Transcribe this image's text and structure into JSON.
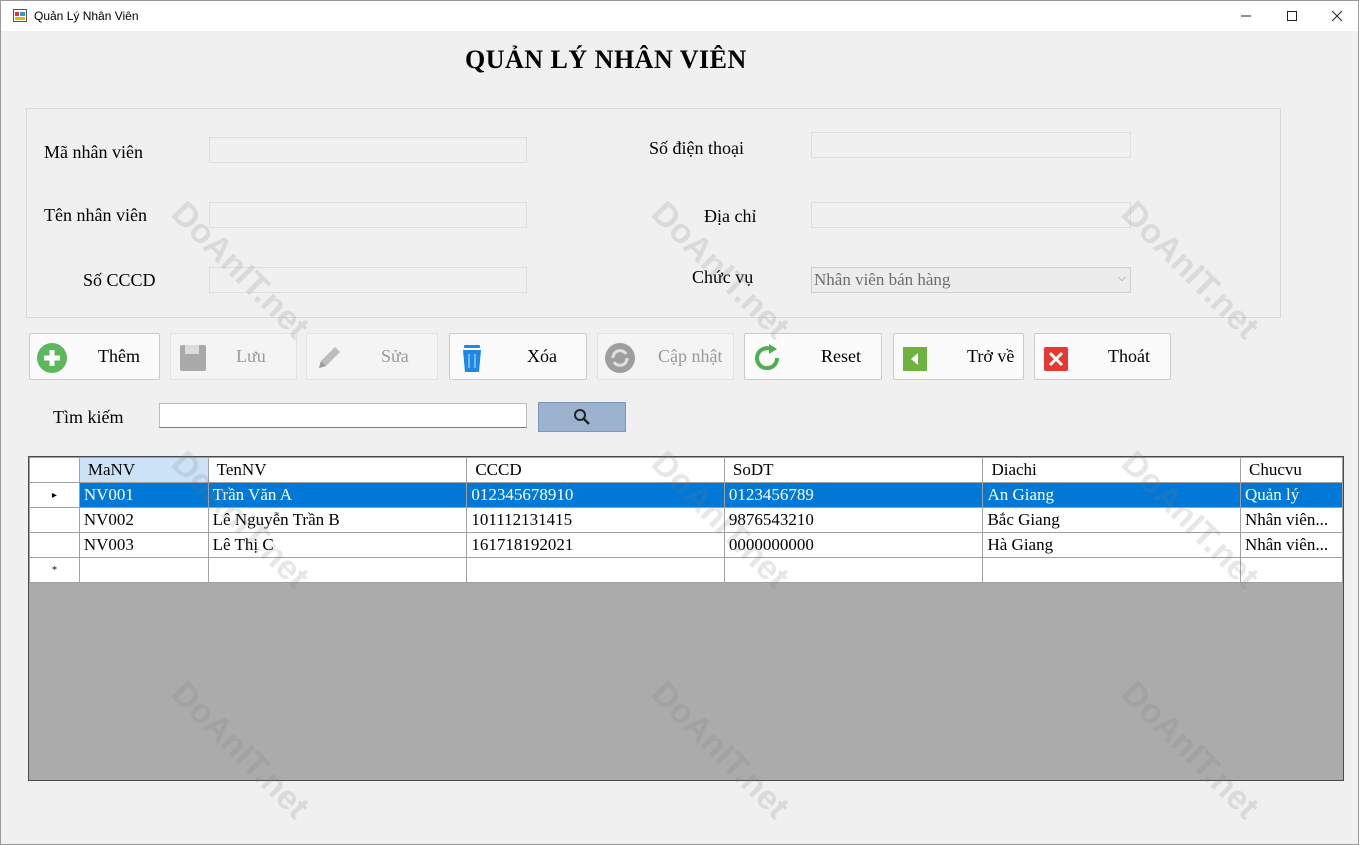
{
  "window": {
    "title": "Quản Lý Nhân Viên",
    "controls": {
      "minimize": "—",
      "maximize": "☐",
      "close": "✕"
    }
  },
  "heading": "QUẢN LÝ NHÂN VIÊN",
  "form": {
    "ma_nv_label": "Mã nhân viên",
    "ten_nv_label": "Tên nhân viên",
    "cccd_label": "Số CCCD",
    "sdt_label": "Số điện thoại",
    "diachi_label": "Địa chỉ",
    "chucvu_label": "Chức vụ",
    "ma_nv_value": "",
    "ten_nv_value": "",
    "cccd_value": "",
    "sdt_value": "",
    "diachi_value": "",
    "chucvu_selected": "Nhân viên bán hàng"
  },
  "toolbar": {
    "them": "Thêm",
    "luu": "Lưu",
    "sua": "Sửa",
    "xoa": "Xóa",
    "capnhat": "Cập nhật",
    "reset": "Reset",
    "trove": "Trở về",
    "thoat": "Thoát"
  },
  "search": {
    "label": "Tìm kiếm",
    "value": ""
  },
  "grid": {
    "columns": [
      "MaNV",
      "TenNV",
      "CCCD",
      "SoDT",
      "Diachi",
      "Chucvu"
    ],
    "rows": [
      [
        "NV001",
        "Trần Văn A",
        "012345678910",
        "0123456789",
        "An Giang",
        "Quản lý"
      ],
      [
        "NV002",
        "Lê Nguyễn Trần B",
        "101112131415",
        "9876543210",
        "Bắc Giang",
        "Nhân viên..."
      ],
      [
        "NV003",
        "Lê Thị C",
        "161718192021",
        "0000000000",
        "Hà Giang",
        "Nhân viên..."
      ]
    ],
    "selected_row_marker": "▸",
    "new_row_marker": "*"
  },
  "watermark": "DoAnIT.net",
  "colors": {
    "selection": "#0078d7",
    "search_button": "#9bb3cf",
    "grid_background": "#ababab"
  }
}
